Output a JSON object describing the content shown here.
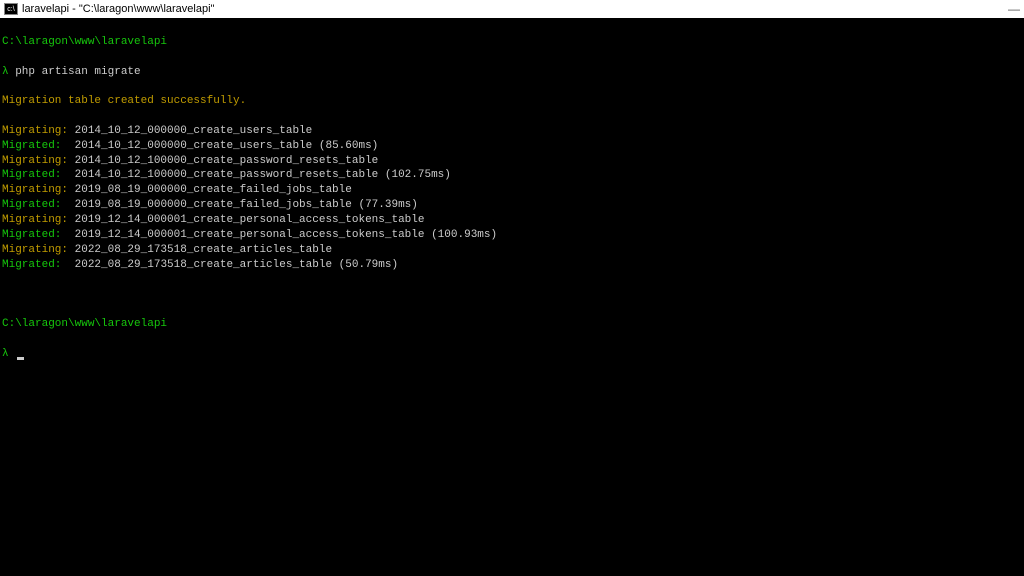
{
  "titlebar": {
    "icon_label": "cmd",
    "title": "laravelapi - \"C:\\laragon\\www\\laravelapi\"",
    "minimize": "—"
  },
  "term": {
    "path1": "C:\\laragon\\www\\laravelapi",
    "prompt_lambda": "λ",
    "command": " php artisan migrate",
    "success_msg": "Migration table created successfully.",
    "rows": [
      {
        "status": "Migrating:",
        "name": " 2014_10_12_000000_create_users_table",
        "time": ""
      },
      {
        "status": "Migrated:",
        "name": "  2014_10_12_000000_create_users_table",
        "time": " (85.60ms)"
      },
      {
        "status": "Migrating:",
        "name": " 2014_10_12_100000_create_password_resets_table",
        "time": ""
      },
      {
        "status": "Migrated:",
        "name": "  2014_10_12_100000_create_password_resets_table",
        "time": " (102.75ms)"
      },
      {
        "status": "Migrating:",
        "name": " 2019_08_19_000000_create_failed_jobs_table",
        "time": ""
      },
      {
        "status": "Migrated:",
        "name": "  2019_08_19_000000_create_failed_jobs_table",
        "time": " (77.39ms)"
      },
      {
        "status": "Migrating:",
        "name": " 2019_12_14_000001_create_personal_access_tokens_table",
        "time": ""
      },
      {
        "status": "Migrated:",
        "name": "  2019_12_14_000001_create_personal_access_tokens_table",
        "time": " (100.93ms)"
      },
      {
        "status": "Migrating:",
        "name": " 2022_08_29_173518_create_articles_table",
        "time": ""
      },
      {
        "status": "Migrated:",
        "name": "  2022_08_29_173518_create_articles_table",
        "time": " (50.79ms)"
      }
    ],
    "path2": "C:\\laragon\\www\\laravelapi"
  }
}
